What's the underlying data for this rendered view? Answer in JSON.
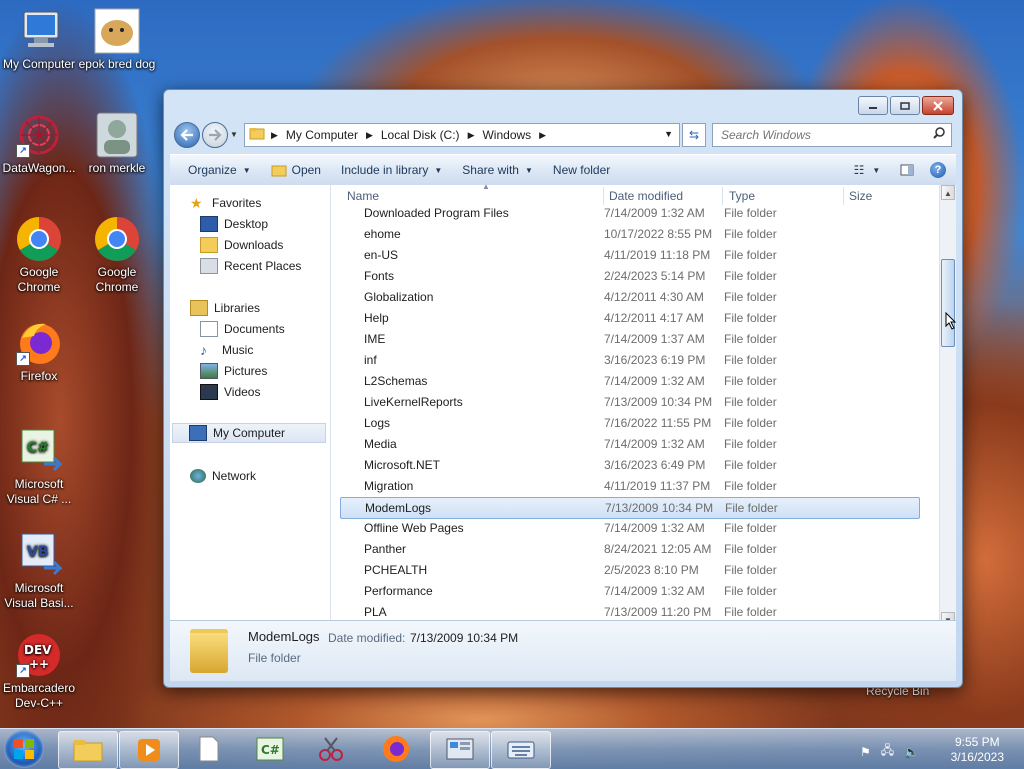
{
  "desktop": {
    "icons": [
      {
        "label": "My Computer"
      },
      {
        "label": "epok bred dog"
      },
      {
        "label": "DataWagon..."
      },
      {
        "label": "ron merkle"
      },
      {
        "label": "Google Chrome"
      },
      {
        "label": "Google Chrome"
      },
      {
        "label": "Firefox"
      },
      {
        "label": "Microsoft Visual C# ..."
      },
      {
        "label": "Microsoft Visual Basi..."
      },
      {
        "label": "Embarcadero Dev-C++"
      }
    ],
    "recycle_bin": "Recycle Bin"
  },
  "window": {
    "address": {
      "crumbs": [
        "My Computer",
        "Local Disk (C:)",
        "Windows"
      ]
    },
    "search": {
      "placeholder": "Search Windows"
    },
    "toolbar": {
      "organize": "Organize",
      "open": "Open",
      "include_in_library": "Include in library",
      "share_with": "Share with",
      "new_folder": "New folder"
    },
    "nav": {
      "favorites": "Favorites",
      "desktop": "Desktop",
      "downloads": "Downloads",
      "recent_places": "Recent Places",
      "libraries": "Libraries",
      "documents": "Documents",
      "music": "Music",
      "pictures": "Pictures",
      "videos": "Videos",
      "my_computer": "My Computer",
      "network": "Network"
    },
    "columns": {
      "name": "Name",
      "date_modified": "Date modified",
      "type": "Type",
      "size": "Size"
    },
    "files": [
      {
        "name": "Downloaded Program Files",
        "date": "7/14/2009 1:32 AM",
        "type": "File folder"
      },
      {
        "name": "ehome",
        "date": "10/17/2022 8:55 PM",
        "type": "File folder"
      },
      {
        "name": "en-US",
        "date": "4/11/2019 11:18 PM",
        "type": "File folder"
      },
      {
        "name": "Fonts",
        "date": "2/24/2023 5:14 PM",
        "type": "File folder"
      },
      {
        "name": "Globalization",
        "date": "4/12/2011 4:30 AM",
        "type": "File folder"
      },
      {
        "name": "Help",
        "date": "4/12/2011 4:17 AM",
        "type": "File folder"
      },
      {
        "name": "IME",
        "date": "7/14/2009 1:37 AM",
        "type": "File folder"
      },
      {
        "name": "inf",
        "date": "3/16/2023 6:19 PM",
        "type": "File folder"
      },
      {
        "name": "L2Schemas",
        "date": "7/14/2009 1:32 AM",
        "type": "File folder"
      },
      {
        "name": "LiveKernelReports",
        "date": "7/13/2009 10:34 PM",
        "type": "File folder"
      },
      {
        "name": "Logs",
        "date": "7/16/2022 11:55 PM",
        "type": "File folder"
      },
      {
        "name": "Media",
        "date": "7/14/2009 1:32 AM",
        "type": "File folder"
      },
      {
        "name": "Microsoft.NET",
        "date": "3/16/2023 6:49 PM",
        "type": "File folder"
      },
      {
        "name": "Migration",
        "date": "4/11/2019 11:37 PM",
        "type": "File folder"
      },
      {
        "name": "ModemLogs",
        "date": "7/13/2009 10:34 PM",
        "type": "File folder"
      },
      {
        "name": "Offline Web Pages",
        "date": "7/14/2009 1:32 AM",
        "type": "File folder"
      },
      {
        "name": "Panther",
        "date": "8/24/2021 12:05 AM",
        "type": "File folder"
      },
      {
        "name": "PCHEALTH",
        "date": "2/5/2023 8:10 PM",
        "type": "File folder"
      },
      {
        "name": "Performance",
        "date": "7/14/2009 1:32 AM",
        "type": "File folder"
      },
      {
        "name": "PLA",
        "date": "7/13/2009 11:20 PM",
        "type": "File folder"
      }
    ],
    "details": {
      "name": "ModemLogs",
      "date_label": "Date modified:",
      "date": "7/13/2009 10:34 PM",
      "type": "File folder"
    }
  },
  "taskbar": {
    "clock_time": "9:55 PM",
    "clock_date": "3/16/2023"
  }
}
